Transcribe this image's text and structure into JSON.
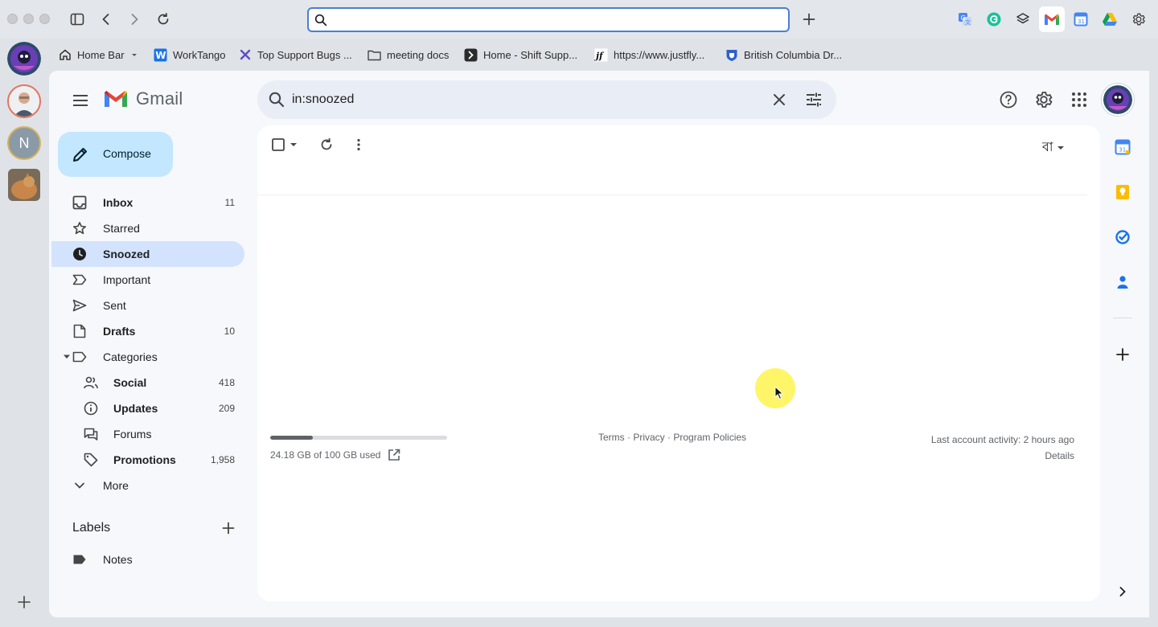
{
  "browser": {
    "address_value": "",
    "bookmarks": [
      {
        "label": "Home Bar",
        "icon": "home-icon"
      },
      {
        "label": "WorkTango",
        "icon": "worktango-icon"
      },
      {
        "label": "Top Support Bugs ...",
        "icon": "jira-icon"
      },
      {
        "label": "meeting docs",
        "icon": "folder-icon"
      },
      {
        "label": "Home - Shift Supp...",
        "icon": "shift-icon"
      },
      {
        "label": "https://www.justfly...",
        "icon": "justfly-icon"
      },
      {
        "label": "British Columbia Dr...",
        "icon": "bc-shield-icon"
      }
    ],
    "profile_initial": "N"
  },
  "gmail": {
    "app_name": "Gmail",
    "search_value": "in:snoozed",
    "compose_label": "Compose",
    "nav": [
      {
        "label": "Inbox",
        "count": "11",
        "bold": true,
        "icon": "inbox-icon"
      },
      {
        "label": "Starred",
        "count": "",
        "bold": false,
        "icon": "star-icon"
      },
      {
        "label": "Snoozed",
        "count": "",
        "bold": true,
        "icon": "clock-icon",
        "active": true
      },
      {
        "label": "Important",
        "count": "",
        "bold": false,
        "icon": "important-icon"
      },
      {
        "label": "Sent",
        "count": "",
        "bold": false,
        "icon": "send-icon"
      },
      {
        "label": "Drafts",
        "count": "10",
        "bold": true,
        "icon": "draft-icon"
      },
      {
        "label": "Categories",
        "count": "",
        "bold": false,
        "icon": "label-icon"
      },
      {
        "label": "Social",
        "count": "418",
        "bold": true,
        "icon": "people-icon"
      },
      {
        "label": "Updates",
        "count": "209",
        "bold": true,
        "icon": "info-icon"
      },
      {
        "label": "Forums",
        "count": "",
        "bold": false,
        "icon": "forum-icon"
      },
      {
        "label": "Promotions",
        "count": "1,958",
        "bold": true,
        "icon": "tag-icon"
      },
      {
        "label": "More",
        "count": "",
        "bold": false,
        "icon": "chevron-down-icon"
      }
    ],
    "labels_heading": "Labels",
    "labels": [
      {
        "label": "Notes",
        "icon": "label-filled-icon"
      }
    ],
    "toolbar": {
      "language": "বা"
    },
    "storage": {
      "text": "24.18 GB of 100 GB used",
      "used_fraction": 0.2418
    },
    "footer": {
      "terms": "Terms",
      "sep1": " · ",
      "privacy": "Privacy",
      "sep2": " · ",
      "policies": "Program Policies",
      "activity": "Last account activity: 2 hours ago",
      "details": "Details"
    }
  },
  "colors": {
    "accent": "#0b57d0",
    "compose_bg": "#c2e7ff",
    "active_nav": "#d3e3fd",
    "search_bg": "#e9eef6"
  }
}
